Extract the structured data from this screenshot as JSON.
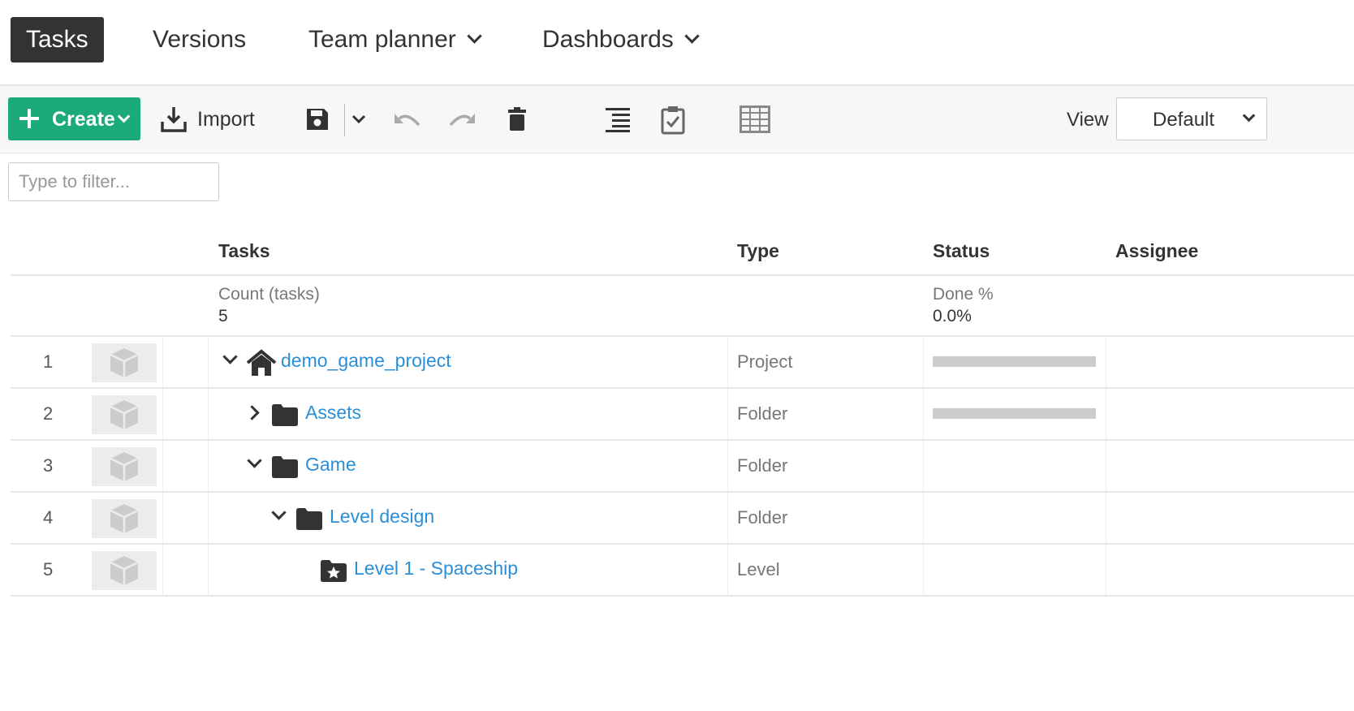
{
  "nav": {
    "tabs": [
      {
        "label": "Tasks",
        "active": true
      },
      {
        "label": "Versions"
      },
      {
        "label": "Team planner",
        "dropdown": true
      },
      {
        "label": "Dashboards",
        "dropdown": true
      }
    ]
  },
  "toolbar": {
    "create_label": "Create",
    "import_label": "Import",
    "view_label": "View",
    "view_value": "Default",
    "accent": "#1aaa7c"
  },
  "filter": {
    "placeholder": "Type to filter...",
    "value": ""
  },
  "table": {
    "columns": [
      "Tasks",
      "Type",
      "Status",
      "Assignee"
    ],
    "summary": {
      "count_label": "Count (tasks)",
      "count_value": "5",
      "done_label": "Done %",
      "done_value": "0.0%"
    },
    "rows": [
      {
        "num": "1",
        "name": "demo_game_project",
        "type": "Project",
        "icon": "house-icon",
        "expanded": true,
        "progress": 0
      },
      {
        "num": "2",
        "name": "Assets",
        "type": "Folder",
        "icon": "folder-icon",
        "expanded": false,
        "progress": 0
      },
      {
        "num": "3",
        "name": "Game",
        "type": "Folder",
        "icon": "folder-icon",
        "expanded": true
      },
      {
        "num": "4",
        "name": "Level design",
        "type": "Folder",
        "icon": "folder-icon",
        "expanded": true
      },
      {
        "num": "5",
        "name": "Level 1 - Spaceship",
        "type": "Level",
        "icon": "star-folder-icon"
      }
    ]
  },
  "link_color": "#2a8fd6"
}
